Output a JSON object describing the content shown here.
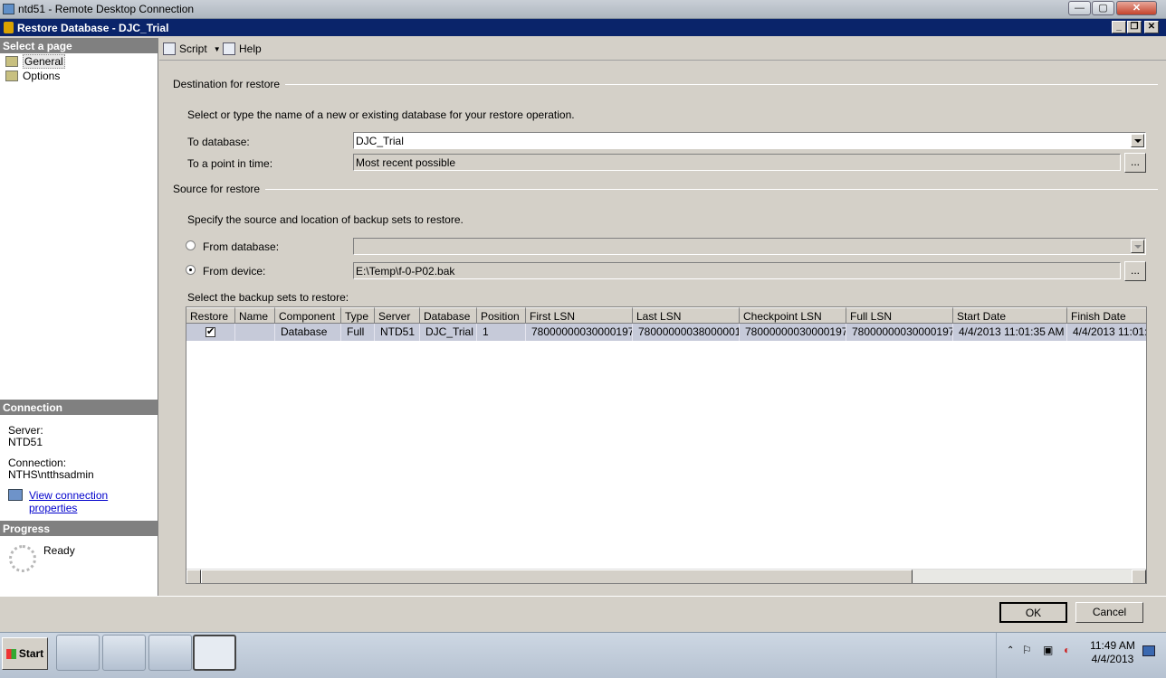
{
  "rdp": {
    "title": "ntd51 - Remote Desktop Connection",
    "min": "—",
    "max": "▢",
    "close": "✕"
  },
  "window": {
    "title": "Restore Database - DJC_Trial"
  },
  "left": {
    "select_page_header": "Select a page",
    "pages": [
      "General",
      "Options"
    ],
    "connection_header": "Connection",
    "server_label": "Server:",
    "server_value": "NTD51",
    "connection_label": "Connection:",
    "connection_value": "NTHS\\ntthsadmin",
    "view_props_link": "View connection properties",
    "progress_header": "Progress",
    "progress_status": "Ready"
  },
  "toolbar": {
    "script": "Script",
    "help": "Help"
  },
  "destination": {
    "header": "Destination for restore",
    "description": "Select or type the name of a new or existing database for your restore operation.",
    "to_database_label": "To database:",
    "to_database_value": "DJC_Trial",
    "point_in_time_label": "To a point in time:",
    "point_in_time_value": "Most recent possible",
    "browse": "..."
  },
  "source": {
    "header": "Source for restore",
    "description": "Specify the source and location of backup sets to restore.",
    "from_database_label": "From database:",
    "from_database_value": "",
    "from_device_label": "From device:",
    "from_device_value": "E:\\Temp\\f-0-P02.bak",
    "selected_option": "from_device",
    "browse": "...",
    "grid_label": "Select the backup sets to restore:"
  },
  "grid": {
    "columns": [
      "Restore",
      "Name",
      "Component",
      "Type",
      "Server",
      "Database",
      "Position",
      "First LSN",
      "Last LSN",
      "Checkpoint LSN",
      "Full LSN",
      "Start Date",
      "Finish Date"
    ],
    "rows": [
      {
        "restore": true,
        "name": "",
        "component": "Database",
        "type": "Full",
        "server": "NTD51",
        "database": "DJC_Trial",
        "position": "1",
        "first_lsn": "78000000030000197",
        "last_lsn": "78000000038000001",
        "checkpoint_lsn": "78000000030000197",
        "full_lsn": "78000000030000197",
        "start_date": "4/4/2013 11:01:35 AM",
        "finish_date": "4/4/2013 11:01:"
      }
    ]
  },
  "buttons": {
    "ok": "OK",
    "cancel": "Cancel"
  },
  "taskbar": {
    "start": "Start",
    "time": "11:49 AM",
    "date": "4/4/2013"
  },
  "colors": {
    "title_bar": "#0a246a",
    "selection_row": "#c6cad9"
  }
}
